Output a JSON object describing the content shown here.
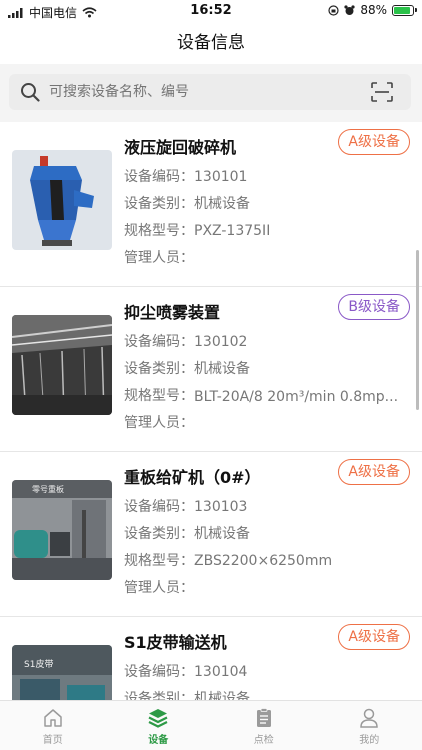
{
  "status_bar": {
    "carrier": "中国电信",
    "time": "16:52",
    "battery_text": "88%",
    "battery_level": 0.88
  },
  "nav": {
    "title": "设备信息"
  },
  "search": {
    "placeholder": "可搜索设备名称、编号"
  },
  "field_labels": {
    "code": "设备编码：",
    "category": "设备类别：",
    "model": "规格型号：",
    "manager": "管理人员："
  },
  "equipment": [
    {
      "name": "液压旋回破碎机",
      "grade": "A级设备",
      "code": "130101",
      "category": "机械设备",
      "model": "PXZ-1375II",
      "manager": ""
    },
    {
      "name": "抑尘喷雾装置",
      "grade": "B级设备",
      "code": "130102",
      "category": "机械设备",
      "model": "BLT-20A/8 20m³/min 0.8mp...",
      "manager": ""
    },
    {
      "name": "重板给矿机（0#）",
      "grade": "A级设备",
      "code": "130103",
      "category": "机械设备",
      "model": "ZBS2200×6250mm",
      "manager": "",
      "image_text": "零号重板"
    },
    {
      "name": "S1皮带输送机",
      "grade": "A级设备",
      "code": "130104",
      "category": "机械设备",
      "model": "",
      "manager": "",
      "image_text": "S1皮带"
    }
  ],
  "tabs": [
    {
      "label": "首页",
      "icon": "home-icon"
    },
    {
      "label": "设备",
      "icon": "layers-icon",
      "active": true
    },
    {
      "label": "点检",
      "icon": "clipboard-icon"
    },
    {
      "label": "我的",
      "icon": "user-icon"
    }
  ],
  "colors": {
    "accent": "#2d9a46",
    "grade_a": "#ee7046",
    "grade_b": "#8a59c7"
  }
}
